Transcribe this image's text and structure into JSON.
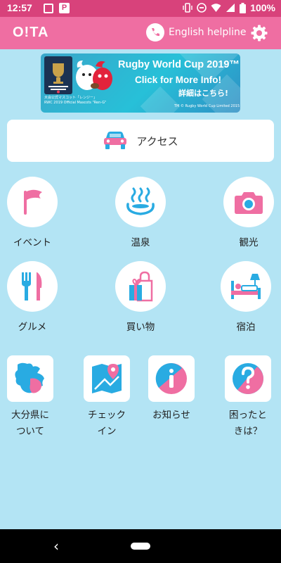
{
  "status_bar": {
    "time": "12:57",
    "battery": "100%"
  },
  "header": {
    "logo": "O!TA",
    "helpline_label": "English helpline"
  },
  "banner": {
    "title": "Rugby World Cup 2019™",
    "cta": "Click for More Info!",
    "cta_jp": "詳細はこちら!",
    "mascot_caption_line1": "大会公式マスコット「レンジー」",
    "mascot_caption_line2": "RWC 2019 Official Mascots \"Ren-G\"",
    "copyright": "TM © Rugby World Cup Limited 2015"
  },
  "access": {
    "label": "アクセス"
  },
  "menu": {
    "event": "イベント",
    "onsen": "温泉",
    "sightseeing": "観光",
    "gourmet": "グルメ",
    "shopping": "買い物",
    "lodging": "宿泊"
  },
  "tiles": {
    "about_line1": "大分県に",
    "about_line2": "ついて",
    "checkin_line1": "チェック",
    "checkin_line2": "イン",
    "news": "お知らせ",
    "help_line1": "困ったと",
    "help_line2": "きは？"
  },
  "colors": {
    "status_bar": "#d8427b",
    "header": "#ef6ea2",
    "background": "#b3e4f4",
    "pink": "#ef6ea2",
    "blue": "#29abe2"
  }
}
